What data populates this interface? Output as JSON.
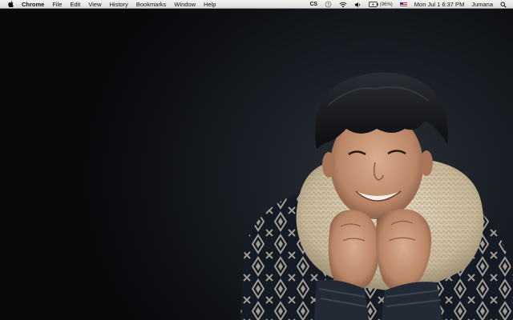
{
  "menubar": {
    "app_name": "Chrome",
    "items": [
      "File",
      "Edit",
      "View",
      "History",
      "Bookmarks",
      "Window",
      "Help"
    ],
    "status": {
      "cs_label": "CS",
      "battery_percent": "(96%)",
      "date_time": "Mon Jul 1  6:37 PM",
      "user_name": "Jumana"
    },
    "icons": [
      "apple-logo-icon",
      "time-machine-icon",
      "wifi-icon",
      "volume-icon",
      "battery-icon",
      "flag-icon",
      "spotlight-icon"
    ]
  },
  "desktop": {
    "wallpaper": "portrait-photo"
  },
  "colors": {
    "menubar_bg": "#e6e6e6",
    "wallpaper_dark": "#0b0d11",
    "sweater_cream": "#d9cbb0",
    "sweater_navy": "#1e2633"
  }
}
